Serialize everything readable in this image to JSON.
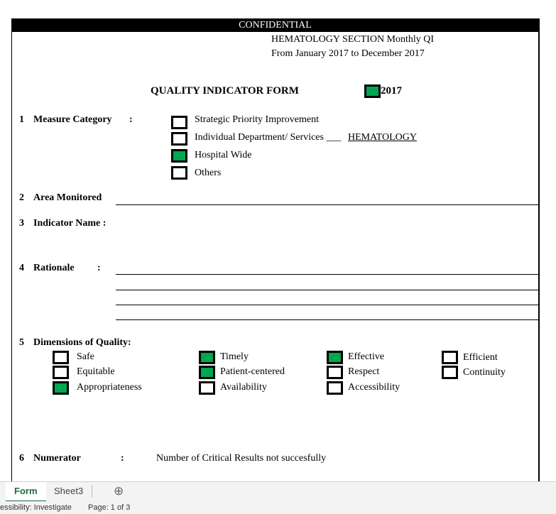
{
  "header": {
    "confidential": "CONFIDENTIAL",
    "section": "HEMATOLOGY SECTION Monthly QI",
    "period": "From January 2017 to December 2017"
  },
  "form_title": "QUALITY INDICATOR FORM",
  "year": "2017",
  "year_checked": true,
  "sections": {
    "s1": {
      "num": "1",
      "label": "Measure Category",
      "colon": ":",
      "options": [
        {
          "label": "Strategic Priority Improvement",
          "checked": false
        },
        {
          "label": "Individual Department/ Services ___",
          "checked": false,
          "value": "HEMATOLOGY"
        },
        {
          "label": "Hospital Wide",
          "checked": true
        },
        {
          "label": "Others",
          "checked": false
        }
      ]
    },
    "s2": {
      "num": "2",
      "label": "Area Monitored"
    },
    "s3": {
      "num": "3",
      "label": "Indicator Name :"
    },
    "s4": {
      "num": "4",
      "label": "Rationale",
      "colon": ":"
    },
    "s5": {
      "num": "5",
      "label": "Dimensions of Quality:",
      "options": [
        {
          "label": "Safe",
          "checked": false
        },
        {
          "label": "Equitable",
          "checked": false
        },
        {
          "label": "Appropriateness",
          "checked": true
        },
        {
          "label": "Timely",
          "checked": true
        },
        {
          "label": "Patient-centered",
          "checked": true
        },
        {
          "label": "Availability",
          "checked": false
        },
        {
          "label": "Effective",
          "checked": true
        },
        {
          "label": "Respect",
          "checked": false
        },
        {
          "label": "Accessibility",
          "checked": false
        },
        {
          "label": "Efficient",
          "checked": false
        },
        {
          "label": "Continuity",
          "checked": false
        }
      ]
    },
    "s6": {
      "num": "6",
      "label": "Numerator",
      "colon": ":",
      "value": "Number of Critical Results not succesfully"
    }
  },
  "tabs": [
    {
      "label": "Form"
    },
    {
      "label": "Sheet3"
    }
  ],
  "add_sheet": "⊕",
  "status": {
    "accessibility": "essibility: Investigate",
    "page": "Page: 1 of 3"
  },
  "colors": {
    "checked": "#00a651"
  }
}
